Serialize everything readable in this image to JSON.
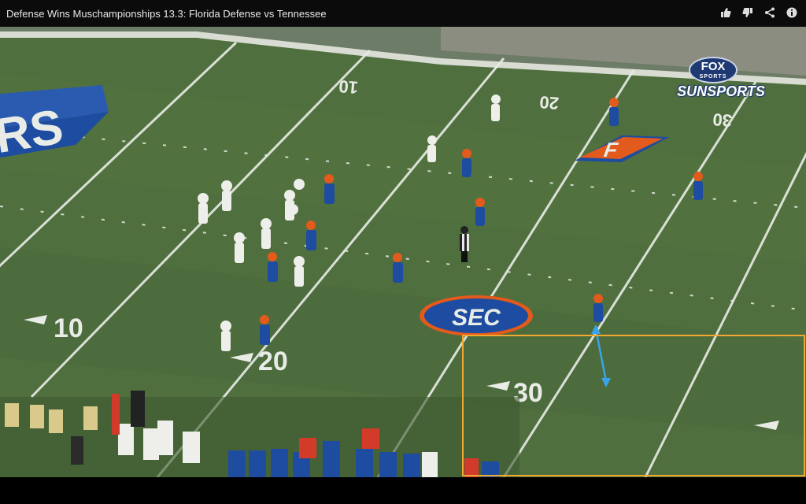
{
  "window": {
    "title": "Defense Wins Muschampionships 13.3: Florida Defense vs Tennessee"
  },
  "actions": [
    {
      "name": "like-icon",
      "glyph": "👍"
    },
    {
      "name": "dislike-icon",
      "glyph": "👎"
    },
    {
      "name": "share-icon",
      "glyph": "share"
    },
    {
      "name": "info-icon",
      "glyph": "i"
    }
  ],
  "broadcast": {
    "network_badge": "FOX",
    "network_badge_sub": "SPORTS",
    "network_name": "SUNSPORTS"
  },
  "field": {
    "yard_numbers": [
      "10",
      "20",
      "30",
      "10",
      "20",
      "30"
    ],
    "midfield_logo": "SEC",
    "endzone_text": "RS",
    "team_logo": "F"
  },
  "colors": {
    "turf": "#4e6e3e",
    "lines": "#e9ece6",
    "florida_blue": "#1d4ca0",
    "florida_orange": "#e25a1c",
    "highlight": "#f0a830",
    "arrow": "#3aa3ea"
  }
}
